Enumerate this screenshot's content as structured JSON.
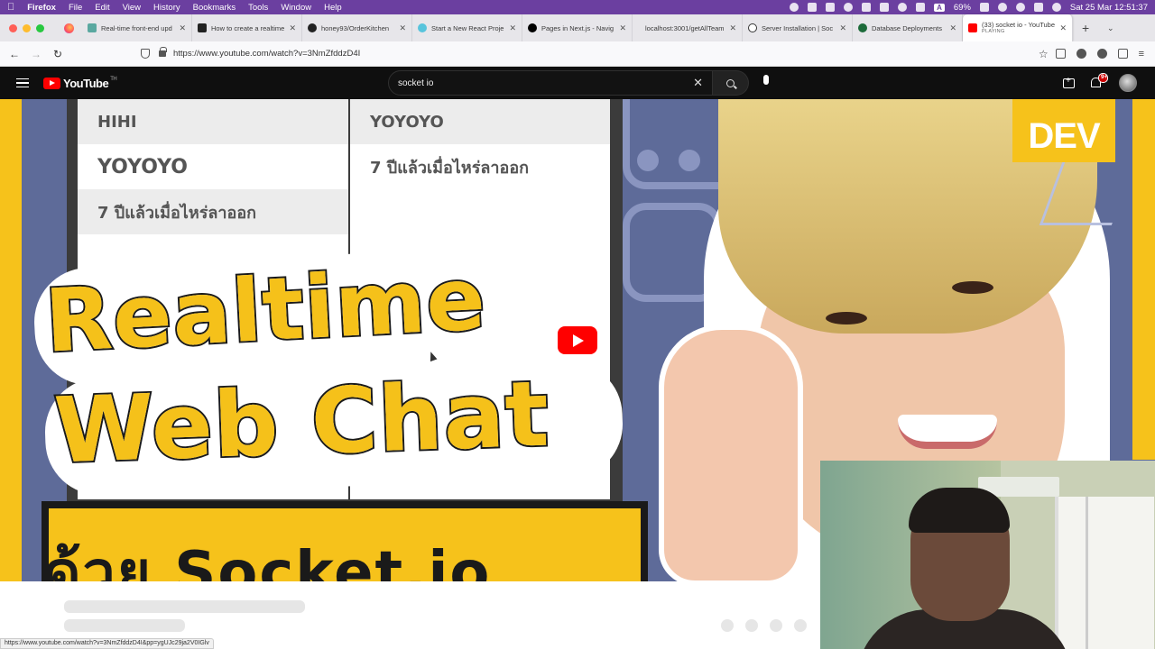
{
  "menubar": {
    "app_name": "Firefox",
    "items": [
      "File",
      "Edit",
      "View",
      "History",
      "Bookmarks",
      "Tools",
      "Window",
      "Help"
    ],
    "battery": "69%",
    "datetime": "Sat 25 Mar  12:51:37",
    "input_source": "A"
  },
  "tabs": [
    {
      "label": "Real-time front-end upd",
      "favicon_color": "#5aa8a0"
    },
    {
      "label": "How to create a realtime",
      "favicon_color": "#222222"
    },
    {
      "label": "honey93/OrderKitchen",
      "favicon_color": "#222222"
    },
    {
      "label": "Start a New React Proje",
      "favicon_color": "#58c4dc"
    },
    {
      "label": "Pages in Next.js - Navig",
      "favicon_color": "#000000"
    },
    {
      "label": "localhost:3001/getAllTeam",
      "favicon_color": "#ffffff"
    },
    {
      "label": "Server Installation | Soc",
      "favicon_color": "#333333"
    },
    {
      "label": "Database Deployments",
      "favicon_color": "#1d6b3a"
    }
  ],
  "active_tab": {
    "label": "(33) socket io - YouTube",
    "sub": "PLAYING"
  },
  "navbar": {
    "url": "https://www.youtube.com/watch?v=3NmZfddzD4I"
  },
  "youtube": {
    "logo_text": "YouTube",
    "country_code": "TH",
    "search_value": "socket io",
    "notification_badge": "9+"
  },
  "thumbnail": {
    "chat_left": [
      "HIHI",
      "YOYOYO",
      "7 ปีแล้วเมื่อไหร่ลาออก"
    ],
    "chat_right": [
      "YOYOYO",
      "7 ปีแล้วเมื่อไหร่ลาออก"
    ],
    "dev_badge": "DEV",
    "title_line1": "Realtime",
    "title_line2": "Web Chat",
    "subtitle": "ด้วย Socket.io"
  },
  "statusbar": {
    "link": "https://www.youtube.com/watch?v=3NmZfddzD4I&pp=ygUJc29ja2V0IGlv"
  },
  "colors": {
    "menubar": "#6b3fa0",
    "brand_red": "#ff0000",
    "thumb_yellow": "#f6c21b",
    "thumb_bg": "#5e6b99"
  }
}
